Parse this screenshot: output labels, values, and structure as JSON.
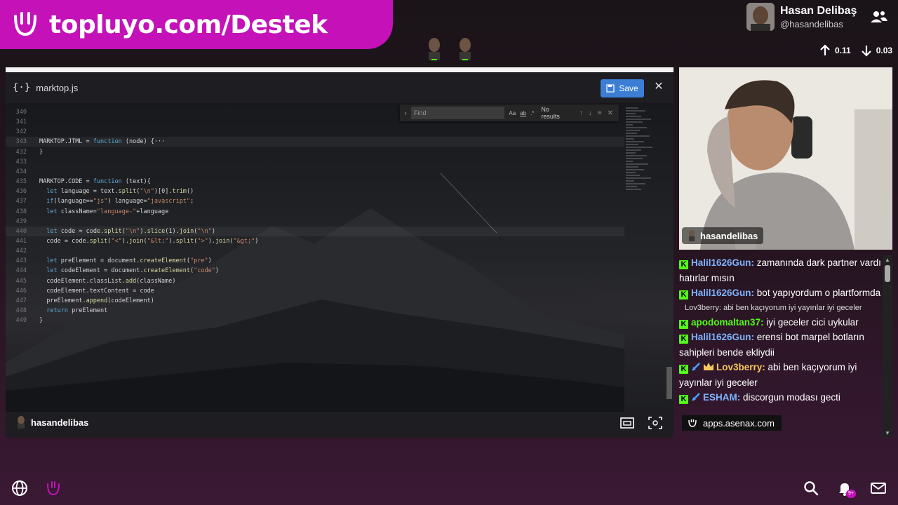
{
  "banner": {
    "text": "topluyo.com/Destek"
  },
  "profile": {
    "name": "Hasan Delibaş",
    "handle": "@hasandelibas"
  },
  "net": {
    "up": "0.11",
    "down": "0.03"
  },
  "editor": {
    "filename": "marktop.js",
    "save_label": "Save",
    "find": {
      "placeholder": "Find",
      "results": "No results",
      "opt_case": "Aa",
      "opt_word": "ab",
      "opt_regex": ".*"
    },
    "footer_user": "hasandelibas",
    "lines": [
      {
        "n": "340",
        "code": ""
      },
      {
        "n": "341",
        "code": ""
      },
      {
        "n": "342",
        "code": ""
      },
      {
        "n": "343",
        "code": "MARKTOP.JTML = function (node) {···"
      },
      {
        "n": "432",
        "code": "}"
      },
      {
        "n": "433",
        "code": ""
      },
      {
        "n": "434",
        "code": ""
      },
      {
        "n": "435",
        "code": "MARKTOP.CODE = function (text){"
      },
      {
        "n": "436",
        "code": "  let language = text.split(\"\\n\")[0].trim()"
      },
      {
        "n": "437",
        "code": "  if(language==\"js\") language=\"javascript\";"
      },
      {
        "n": "438",
        "code": "  let className=\"language-\"+language"
      },
      {
        "n": "439",
        "code": ""
      },
      {
        "n": "440",
        "code": "  let code = code.split(\"\\n\").slice(1).join(\"\\n\")"
      },
      {
        "n": "441",
        "code": "  code = code.split(\"<\").join(\"&lt;\").split(\">\").join(\"&gt;\")"
      },
      {
        "n": "442",
        "code": ""
      },
      {
        "n": "443",
        "code": "  let preElement = document.createElement(\"pre\")"
      },
      {
        "n": "444",
        "code": "  let codeElement = document.createElement(\"code\")"
      },
      {
        "n": "445",
        "code": "  codeElement.classList.add(className)"
      },
      {
        "n": "446",
        "code": "  codeElement.textContent = code"
      },
      {
        "n": "447",
        "code": "  preElement.append(codeElement)"
      },
      {
        "n": "448",
        "code": "  return preElement"
      },
      {
        "n": "449",
        "code": "}"
      }
    ]
  },
  "webcam": {
    "label": "hasandelibas"
  },
  "chat": {
    "messages": [
      {
        "user": "Halil1626Gun:",
        "color": "#7fb3ff",
        "text": "zamanında dark partner vardı hatırlar mısın",
        "badges": [
          "k"
        ]
      },
      {
        "user": "Halil1626Gun:",
        "color": "#7fb3ff",
        "text": "bot yapıyordum o plartformda",
        "badges": [
          "k"
        ]
      },
      {
        "reply": "Lov3berry: abi ben kaçıyorum iyi yayınlar iyi geceler"
      },
      {
        "user": "apodomaltan37:",
        "color": "#53fc18",
        "text": "iyi geceler cici uykular",
        "badges": [
          "k"
        ]
      },
      {
        "user": "Halil1626Gun:",
        "color": "#7fb3ff",
        "text": "erensi bot marpel botların sahipleri bende ekliydii",
        "badges": [
          "k"
        ]
      },
      {
        "user": "Lov3berry:",
        "color": "#f7c75a",
        "text": "abi ben kaçıyorum iyi yayınlar iyi geceler",
        "badges": [
          "k",
          "sword",
          "crown"
        ]
      },
      {
        "user": "ESHAM:",
        "color": "#7fb3ff",
        "text": "discorgun modası gecti",
        "badges": [
          "k",
          "sword"
        ]
      }
    ],
    "overlay": "apps.asenax.com"
  },
  "bottom": {
    "notif_count": "9+"
  },
  "colors": {
    "brand": "#c412b8",
    "save": "#3b7ed4",
    "kick_green": "#53fc18"
  }
}
